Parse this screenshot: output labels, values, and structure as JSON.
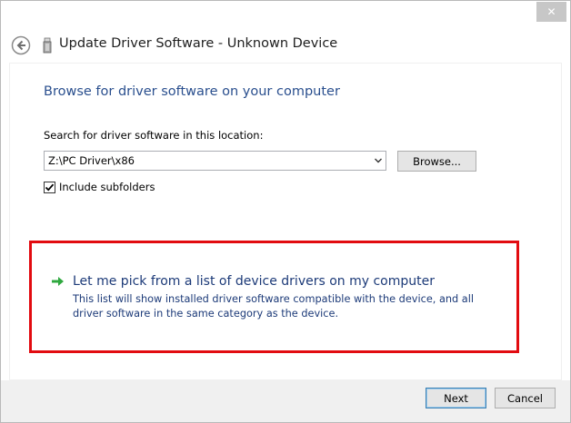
{
  "window": {
    "title": "Update Driver Software - Unknown Device",
    "close_glyph": "✕"
  },
  "header": {
    "back_icon": "back-arrow-icon",
    "device_icon": "usb-device-icon",
    "title": "Update Driver Software - Unknown Device"
  },
  "content": {
    "heading": "Browse for driver software on your computer",
    "search_label": "Search for driver software in this location:",
    "path_value": "Z:\\PC Driver\\x86",
    "browse_label": "Browse...",
    "include_subfolders": {
      "label": "Include subfolders",
      "checked": true
    },
    "pick_option": {
      "title": "Let me pick from a list of device drivers on my computer",
      "description": "This list will show installed driver software compatible with the device, and all driver software in the same category as the device."
    }
  },
  "footer": {
    "next_label": "Next",
    "cancel_label": "Cancel"
  },
  "colors": {
    "heading": "#2a4f8e",
    "link": "#1c3a78",
    "highlight": "#e20b10",
    "arrow": "#2fa83f"
  }
}
